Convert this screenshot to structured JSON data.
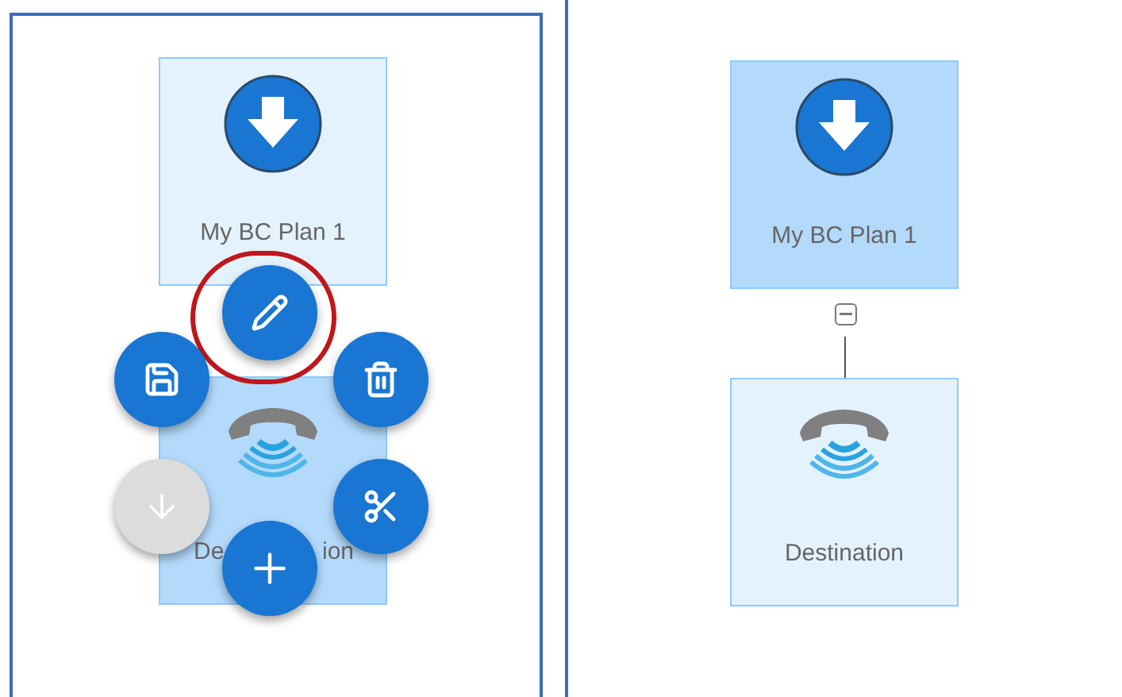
{
  "panels": [
    {
      "focused": true,
      "nodes": [
        {
          "kind": "start",
          "label_parts": [
            "My BC Plan 1"
          ],
          "selected": false
        },
        {
          "kind": "destination",
          "label_parts": [
            "De",
            "ion"
          ],
          "selected": true
        }
      ],
      "actions": [
        {
          "kind": "edit",
          "disabled": false,
          "highlighted": true
        },
        {
          "kind": "save",
          "disabled": false,
          "highlighted": false
        },
        {
          "kind": "delete",
          "disabled": false,
          "highlighted": false
        },
        {
          "kind": "move-down",
          "disabled": true,
          "highlighted": false
        },
        {
          "kind": "cut",
          "disabled": false,
          "highlighted": false
        },
        {
          "kind": "add",
          "disabled": false,
          "highlighted": false
        }
      ]
    },
    {
      "focused": false,
      "toggle": {
        "expanded": true
      },
      "nodes": [
        {
          "kind": "start",
          "label_parts": [
            "My BC Plan 1"
          ],
          "selected": true
        },
        {
          "kind": "destination",
          "label_parts": [
            "Destination"
          ],
          "selected": false
        }
      ]
    }
  ]
}
